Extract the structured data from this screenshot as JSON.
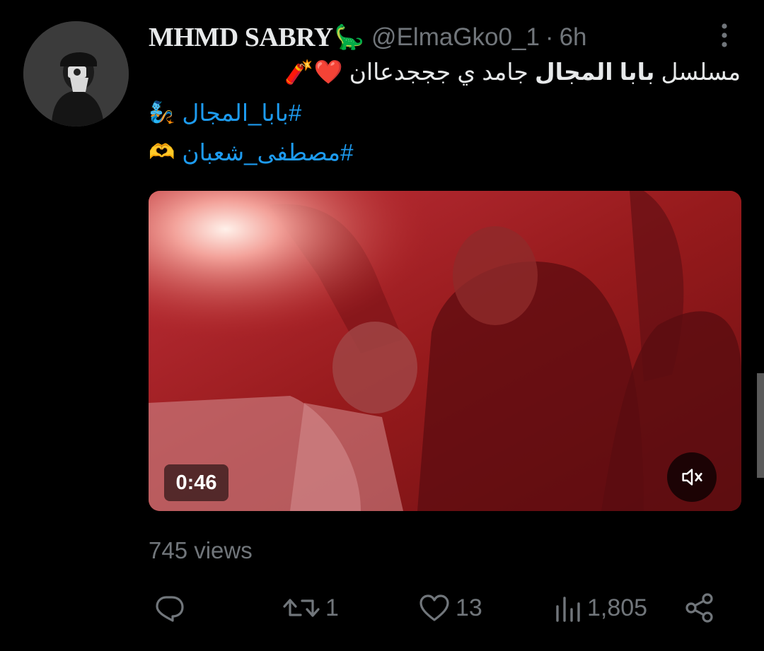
{
  "tweet": {
    "display_name": "MHMD SABRY",
    "name_emoji": "🦕",
    "handle": "@ElmaGko0_1",
    "separator": "·",
    "time": "6h",
    "text_prefix": "مسلسل ",
    "text_bold": "بابا المجال",
    "text_suffix": " جامد ي جججدعاان ❤️🧨",
    "hashtag1": "#بابا_المجال",
    "hashtag1_emoji": "🧞",
    "hashtag2": "#مصطفى_شعبان",
    "hashtag2_emoji": "🫶",
    "avatar_icon": "hooded-person-avatar"
  },
  "media": {
    "duration": "0:46",
    "mute_icon": "volume-muted-icon",
    "tint_color": "#b01c1c"
  },
  "stats": {
    "views_text": "745 views",
    "replies": "",
    "retweets": "1",
    "likes": "13",
    "impressions": "1,805"
  },
  "colors": {
    "background": "#000000",
    "text": "#e7e9ea",
    "secondary": "#71767b",
    "link": "#1d9bf0"
  }
}
